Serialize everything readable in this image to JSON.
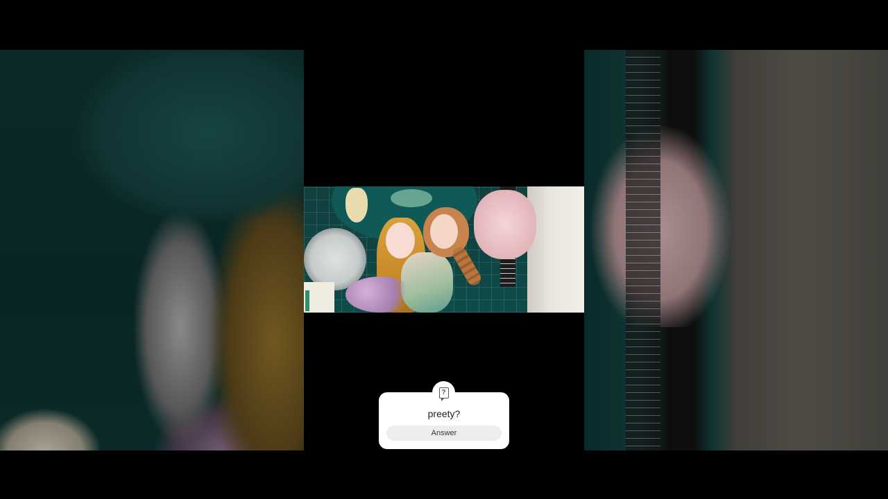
{
  "sticker": {
    "icon": "question-box-icon",
    "icon_glyph": "?",
    "question": "preety?",
    "answer_label": "Answer"
  },
  "colors": {
    "background": "#000000",
    "sticker_bg": "#ffffff",
    "answer_button_bg": "#ededed"
  }
}
